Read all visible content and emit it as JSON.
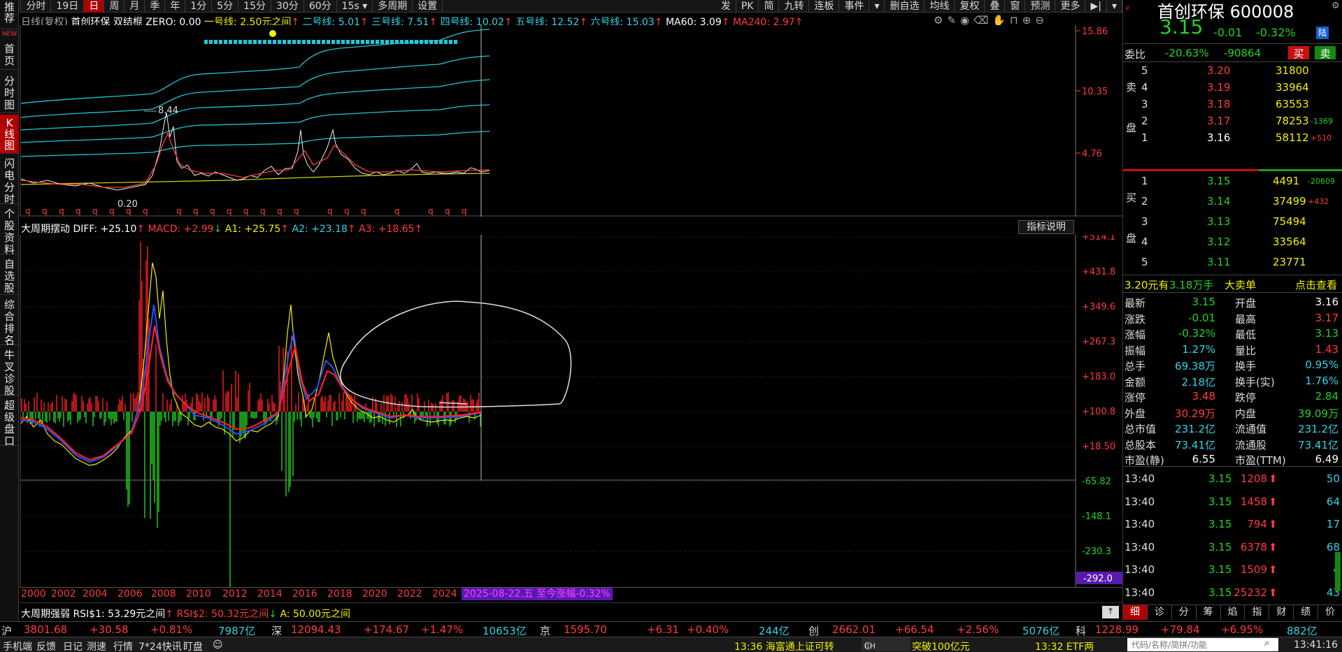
{
  "toolbar": {
    "items": [
      "分时",
      "19日",
      "日",
      "周",
      "月",
      "季",
      "年",
      "1分",
      "5分",
      "15分",
      "30分",
      "60分",
      "15s",
      "多周期",
      "设置"
    ],
    "right_items": [
      "发",
      "PK",
      "简",
      "九转",
      "连板",
      "事件",
      "删自选",
      "均线",
      "复权",
      "叠",
      "窗",
      "预测",
      "更多"
    ]
  },
  "left_nav": [
    "推荐",
    "首页",
    "分时图",
    "K线图",
    "闪电分时",
    "个股资料",
    "自选股",
    "综合排名",
    "牛叉诊股",
    "超级盘口"
  ],
  "left_nav_badge": "NEW",
  "main_chart": {
    "header": {
      "label_period": "日线(复权)",
      "label_name": "首创环保",
      "label_indicator": "双结棍",
      "zero": "ZERO: 0.00",
      "line1": "一号线: 2.50元之间",
      "line2": "二号线: 5.01",
      "line3": "三号线: 7.51",
      "line4": "四号线: 10.02",
      "line5": "五号线: 12.52",
      "line6": "六号线: 15.03",
      "ma60": "MA60: 3.09",
      "ma240": "MA240: 2.97"
    },
    "y_ticks": [
      "15.86",
      "10.35",
      "4.76"
    ],
    "annotation_high": "8.44",
    "annotation_low": "0.20"
  },
  "indicator_panel": {
    "header": {
      "name": "大周期摆动",
      "diff": "DIFF: +25.10",
      "macd": "MACD: +2.99",
      "a1": "A1: +25.75",
      "a2": "A2: +23.18",
      "a3": "A3: +18.65"
    },
    "help_button": "指标说明",
    "y_ticks": [
      "+514.1",
      "+431.8",
      "+349.6",
      "+267.3",
      "+183.0",
      "+100.8",
      "+18.50",
      "-65.82",
      "-148.1",
      "-230.3",
      "-292.0"
    ],
    "x_labels": [
      "2000",
      "2002",
      "2004",
      "2006",
      "2008",
      "2010",
      "2012",
      "2014",
      "2016",
      "2018",
      "2020",
      "2022",
      "2024"
    ],
    "cursor_label": "2025-08-22,五 至今涨幅-0.32%"
  },
  "rsi_panel": {
    "name": "大周期强弱",
    "rsi1": "RSI$1: 53.29元之间",
    "rsi2": "RSI$2: 50.32元之间",
    "a": "A: 50.00元之间"
  },
  "stock": {
    "name": "首创环保",
    "code": "600008",
    "price": "3.15",
    "change": "-0.01",
    "pct": "-0.32%",
    "badge": "陆",
    "weibi_label": "委比",
    "weibi": "-20.63%",
    "weicha": "-90864",
    "buy_btn": "买",
    "sell_btn": "卖"
  },
  "asks": [
    {
      "level": "5",
      "price": "3.20",
      "vol": "31800",
      "chg": ""
    },
    {
      "level": "4",
      "price": "3.19",
      "vol": "33964",
      "chg": ""
    },
    {
      "level": "3",
      "price": "3.18",
      "vol": "63553",
      "chg": ""
    },
    {
      "level": "2",
      "price": "3.17",
      "vol": "78253",
      "chg": "-1369"
    },
    {
      "level": "1",
      "price": "3.16",
      "vol": "58112",
      "chg": "+510"
    }
  ],
  "bids": [
    {
      "level": "1",
      "price": "3.15",
      "vol": "4491",
      "chg": "-20609"
    },
    {
      "level": "2",
      "price": "3.14",
      "vol": "37499",
      "chg": "+432"
    },
    {
      "level": "3",
      "price": "3.13",
      "vol": "75494",
      "chg": ""
    },
    {
      "level": "4",
      "price": "3.12",
      "vol": "33564",
      "chg": ""
    },
    {
      "level": "5",
      "price": "3.11",
      "vol": "23771",
      "chg": ""
    }
  ],
  "ask_side_label": "卖盘",
  "bid_side_label": "买盘",
  "big_order": {
    "price": "3.20元有",
    "amount": "3.18万手",
    "type": "大卖单",
    "link": "点击查看"
  },
  "stats": [
    {
      "l1": "最新",
      "v1": "3.15",
      "l2": "开盘",
      "v2": "3.16"
    },
    {
      "l1": "涨跌",
      "v1": "-0.01",
      "l2": "最高",
      "v2": "3.17"
    },
    {
      "l1": "涨幅",
      "v1": "-0.32%",
      "l2": "最低",
      "v2": "3.13"
    },
    {
      "l1": "振幅",
      "v1": "1.27%",
      "l2": "量比",
      "v2": "1.43"
    },
    {
      "l1": "总手",
      "v1": "69.38万",
      "l2": "换手",
      "v2": "0.95%"
    },
    {
      "l1": "金额",
      "v1": "2.18亿",
      "l2": "换手(实)",
      "v2": "1.76%"
    },
    {
      "l1": "涨停",
      "v1": "3.48",
      "l2": "跌停",
      "v2": "2.84"
    },
    {
      "l1": "外盘",
      "v1": "30.29万",
      "l2": "内盘",
      "v2": "39.09万"
    },
    {
      "l1": "总市值",
      "v1": "231.2亿",
      "l2": "流通值",
      "v2": "231.2亿"
    },
    {
      "l1": "总股本",
      "v1": "73.41亿",
      "l2": "流通股",
      "v2": "73.41亿"
    },
    {
      "l1": "市盈(静)",
      "v1": "6.55",
      "l2": "市盈(TTM)",
      "v2": "6.49"
    }
  ],
  "ticks": [
    {
      "time": "13:40",
      "price": "3.15",
      "vol": "1208",
      "n": "50"
    },
    {
      "time": "13:40",
      "price": "3.15",
      "vol": "1458",
      "n": "64"
    },
    {
      "time": "13:40",
      "price": "3.15",
      "vol": "794",
      "n": "17"
    },
    {
      "time": "13:40",
      "price": "3.15",
      "vol": "6378",
      "n": "68"
    },
    {
      "time": "13:40",
      "price": "3.15",
      "vol": "1509",
      "n": "4"
    },
    {
      "time": "13:40",
      "price": "3.15",
      "vol": "25232",
      "n": "43"
    }
  ],
  "detail_tabs": [
    "细",
    "诊",
    "分",
    "筹",
    "焰",
    "指",
    "财",
    "绩",
    "价"
  ],
  "ticker": {
    "sh_label": "沪",
    "sh": "3801.68",
    "sh_chg": "+30.58",
    "sh_pct": "+0.81%",
    "sh_amt": "7987亿",
    "sz_label": "深",
    "sz": "12094.43",
    "sz_chg": "+174.67",
    "sz_pct": "+1.47%",
    "sz_amt": "10653亿",
    "bj_label": "京",
    "bj": "1595.70",
    "bj_chg": "+6.31",
    "bj_pct": "+0.40%",
    "bj_amt": "244亿",
    "cy_label": "创",
    "cy": "2662.01",
    "cy_chg": "+66.54",
    "cy_pct": "+2.56%",
    "cy_amt": "5076亿",
    "kc_label": "科",
    "kc": "1228.99",
    "kc_chg": "+79.84",
    "kc_pct": "+6.95%",
    "kc_amt": "882亿"
  },
  "status": {
    "items": [
      "手机端",
      "反馈",
      "日记",
      "测速",
      "行情",
      "7*24快讯",
      "盯盘"
    ],
    "news1": "13:36 海富通上证可转",
    "news1b": "突破100亿元",
    "news2": "13:32 ETF两",
    "ime": "CH",
    "search_placeholder": "代码/名称/简拼/功能",
    "clock": "13:41:16"
  },
  "colors": {
    "up": "#ff3b3b",
    "down": "#21d321",
    "accent": "#b00000",
    "band": "#1ec8d8",
    "price_line": "#f0f000"
  }
}
